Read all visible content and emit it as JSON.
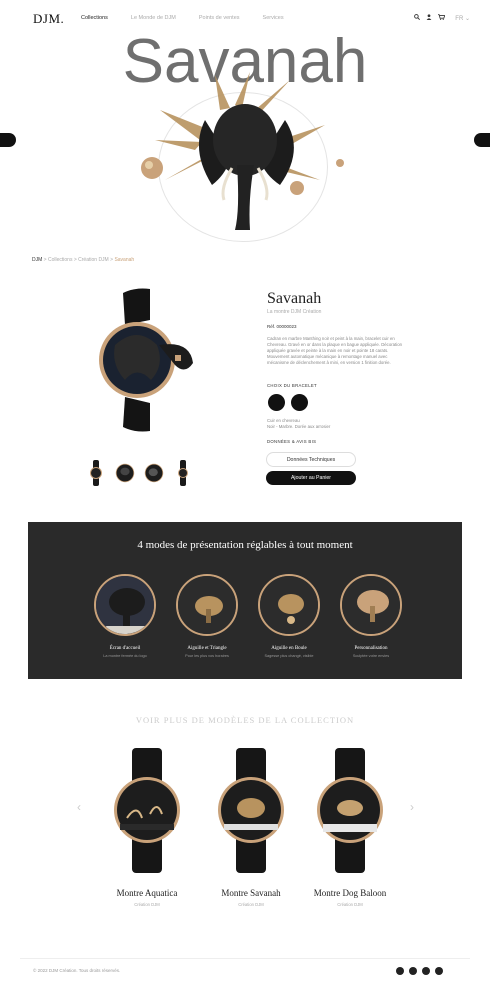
{
  "header": {
    "logo": "DJM.",
    "nav": [
      "Collections",
      "Le Monde de DJM",
      "Points de ventes",
      "Services"
    ],
    "lang": "FR ⌄"
  },
  "hero": {
    "title": "Savanah"
  },
  "breadcrumb": {
    "home": "DJM",
    "sep": ">",
    "items": [
      "Collections",
      "Création DJM"
    ],
    "current": "Savanah"
  },
  "product": {
    "name": "Savanah",
    "subtitle": "La montre DJM Création",
    "ref": "Réf. 00000023",
    "description": "Cadran en marbre Manthing noir et peint à la main, bracelet cuir en Chevreau. Gravé en or dans la plaque en bague appliquée. Décoration appliquée gravée et peinte à la main en noir et pointe 18 carats. Mouvement automatique mécanique à remontage manuel avec mécanisme de déclenchement à mini, en version 1 finition dorée.",
    "color_label": "CHOIX DU BRACELET",
    "color_note": [
      "Cuir en chevreau",
      "Noir - Marbre. Dorée aux arrosier"
    ],
    "desc_label": "DONNÉES & AVIS BIS",
    "tech_button": "Données Techniques",
    "cart_button": "Ajouter au Panier"
  },
  "modes": {
    "title": "4 modes de présentation réglables à tout moment",
    "items": [
      {
        "title": "Écran d'accueil",
        "sub": "La montre fermée du logo"
      },
      {
        "title": "Aiguille et Triangle",
        "sub": "Pour les plus vos horaires"
      },
      {
        "title": "Aiguille en Boule",
        "sub": "Sagesse plus changé, visible"
      },
      {
        "title": "Personnalisation",
        "sub": "Sculptée votre envies"
      }
    ]
  },
  "collection": {
    "title": "VOIR PLUS DE MODÈLES DE LA COLLECTION",
    "prev": "‹",
    "next": "›",
    "items": [
      {
        "name": "Montre Aquatica",
        "sub": "Création DJM"
      },
      {
        "name": "Montre Savanah",
        "sub": "Création DJM"
      },
      {
        "name": "Montre Dog Baloon",
        "sub": "Création DJM"
      }
    ]
  },
  "footer": {
    "copyright": "© 2022 DJM Création. Tous droits réservés."
  },
  "colors": {
    "gold": "#c9a27a",
    "dark": "#2a2a2a",
    "black": "#111111"
  },
  "icons": [
    "search-icon",
    "user-icon",
    "cart-icon",
    "facebook-icon",
    "instagram-icon",
    "pinterest-icon",
    "youtube-icon"
  ]
}
